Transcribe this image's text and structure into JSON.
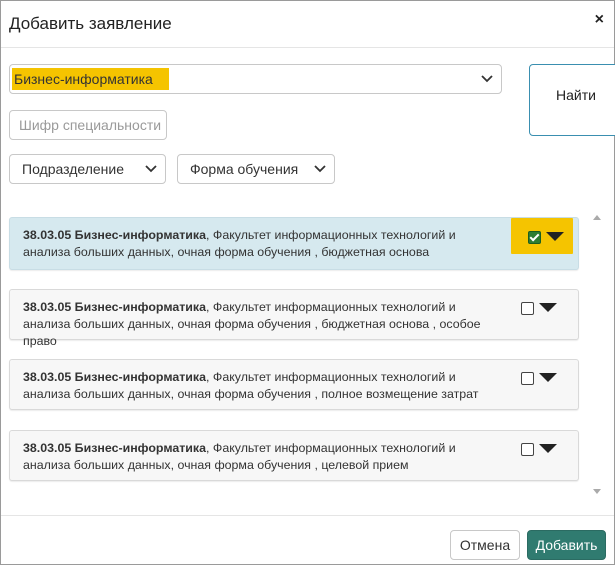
{
  "modal": {
    "title": "Добавить заявление",
    "close_label": "×"
  },
  "filters": {
    "program_select_value": "Бизнес-информатика",
    "specialty_code_placeholder": "Шифр специальности",
    "division_select_value": "Подразделение",
    "study_form_select_value": "Форма обучения",
    "find_button_label": "Найти"
  },
  "results": [
    {
      "code": "38.03.05 Бизнес-информатика",
      "details": ", Факультет информационных технологий и анализа больших данных, очная форма обучения , бюджетная основа",
      "checked": true,
      "selected": true
    },
    {
      "code": "38.03.05 Бизнес-информатика",
      "details": ", Факультет информационных технологий и анализа больших данных, очная форма обучения , бюджетная основа , особое право",
      "checked": false,
      "selected": false
    },
    {
      "code": "38.03.05 Бизнес-информатика",
      "details": ", Факультет информационных технологий и анализа больших данных, очная форма обучения , полное возмещение затрат",
      "checked": false,
      "selected": false
    },
    {
      "code": "38.03.05 Бизнес-информатика",
      "details": ", Факультет информационных технологий и анализа больших данных, очная форма обучения , целевой прием",
      "checked": false,
      "selected": false
    }
  ],
  "footer": {
    "cancel_label": "Отмена",
    "add_label": "Добавить"
  },
  "colors": {
    "highlight": "#f5c400",
    "selected_row": "#d6e9ef",
    "primary_button": "#307b70",
    "checkbox_checked": "#2e7d32"
  }
}
